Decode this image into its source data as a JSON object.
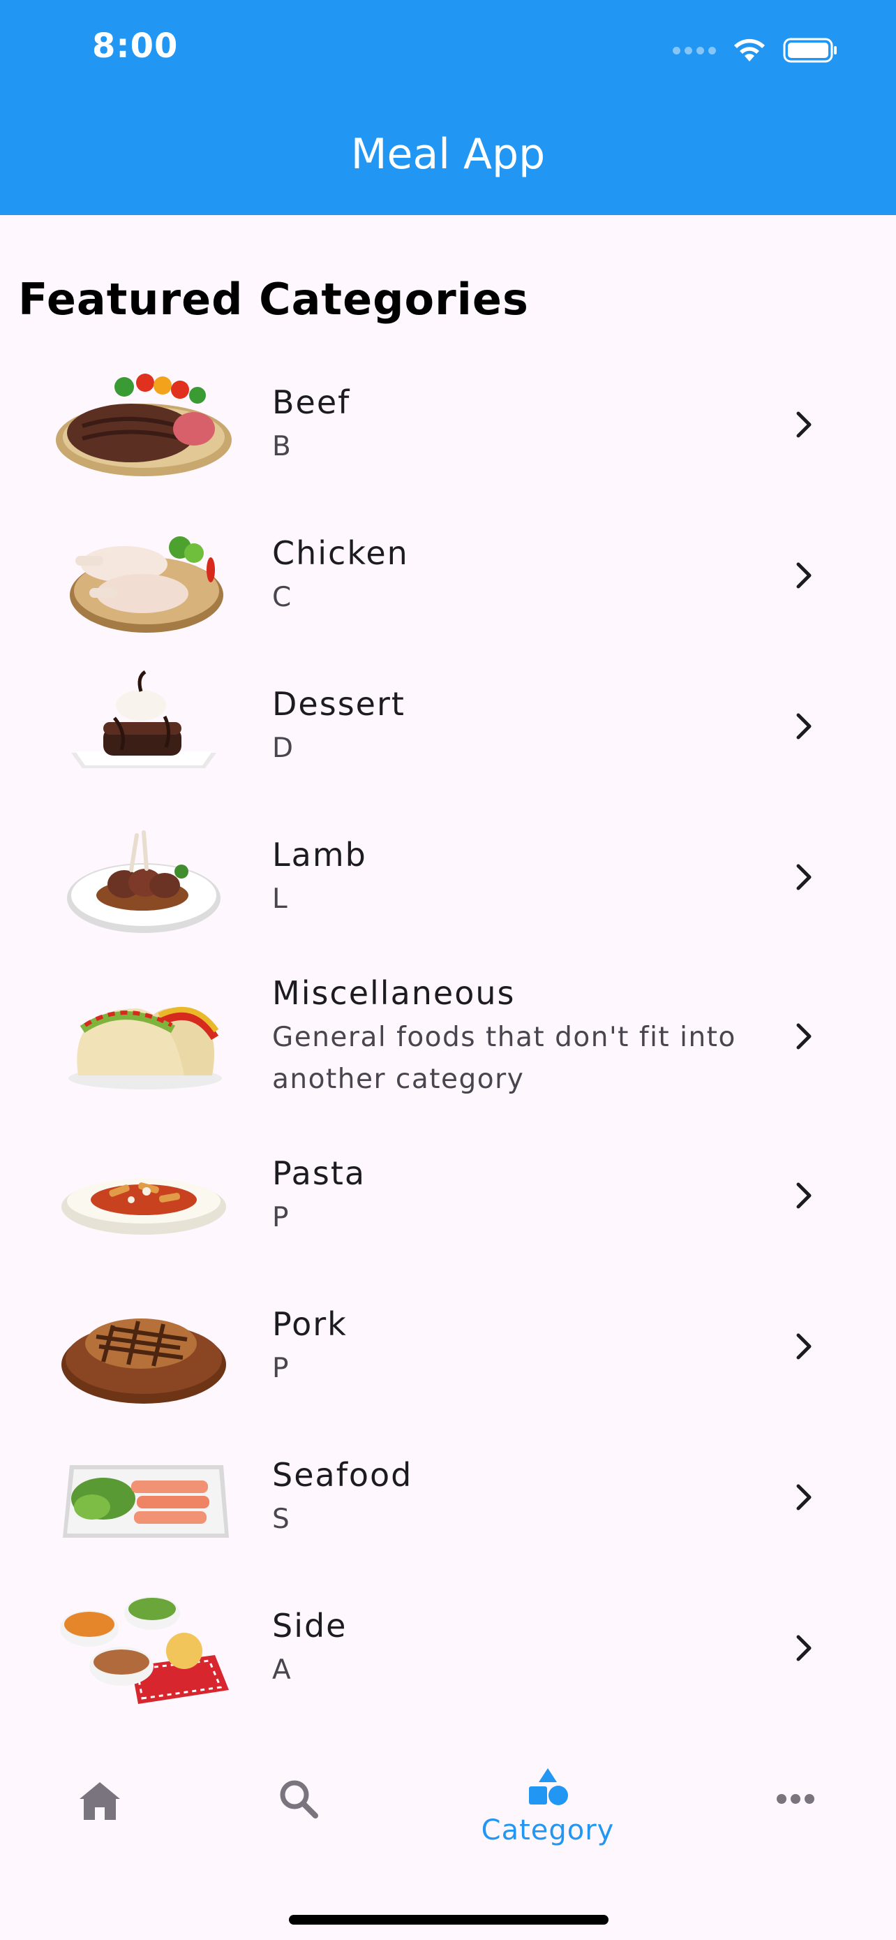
{
  "status_bar": {
    "time": "8:00"
  },
  "app_bar": {
    "title": "Meal App",
    "background_color": "#2196f3"
  },
  "section": {
    "title": "Featured Categories"
  },
  "categories": [
    {
      "name": "Beef",
      "description": "B",
      "thumbnail_icon": "beef-steak-plate"
    },
    {
      "name": "Chicken",
      "description": "C",
      "thumbnail_icon": "chicken-legs-board"
    },
    {
      "name": "Dessert",
      "description": "D",
      "thumbnail_icon": "chocolate-cake-plate"
    },
    {
      "name": "Lamb",
      "description": "L",
      "thumbnail_icon": "lamb-chops-plate"
    },
    {
      "name": "Miscellaneous",
      "description": "General foods that don't fit into another category",
      "thumbnail_icon": "tacos"
    },
    {
      "name": "Pasta",
      "description": "P",
      "thumbnail_icon": "pasta-bowl"
    },
    {
      "name": "Pork",
      "description": "P",
      "thumbnail_icon": "pork-chop-board"
    },
    {
      "name": "Seafood",
      "description": "S",
      "thumbnail_icon": "salmon-platter"
    },
    {
      "name": "Side",
      "description": "A",
      "thumbnail_icon": "side-dishes"
    }
  ],
  "bottom_nav": {
    "items": [
      {
        "id": "home",
        "icon": "home-icon",
        "label": "",
        "active": false
      },
      {
        "id": "search",
        "icon": "search-icon",
        "label": "",
        "active": false
      },
      {
        "id": "category",
        "icon": "category-icon",
        "label": "Category",
        "active": true
      },
      {
        "id": "more",
        "icon": "more-horizontal-icon",
        "label": "",
        "active": false
      }
    ],
    "active_color": "#2196f3",
    "inactive_color": "#79747e"
  }
}
